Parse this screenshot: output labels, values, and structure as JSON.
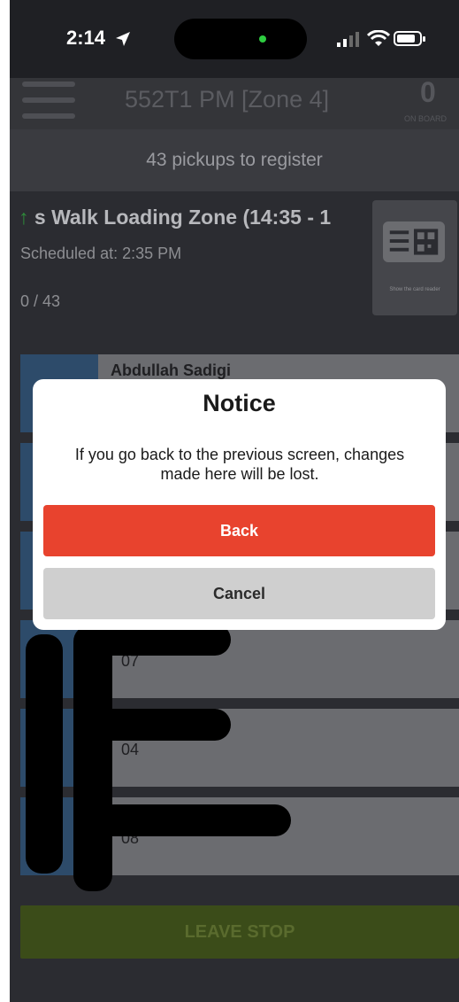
{
  "status_bar": {
    "time": "2:14"
  },
  "header": {
    "route_title": "552T1 PM [Zone 4]",
    "onboard_count": "0",
    "onboard_label": "ON BOARD"
  },
  "pickups_banner": "43 pickups to register",
  "stop": {
    "name": "s Walk Loading Zone (14:35 - 1",
    "scheduled": "Scheduled at: 2:35 PM",
    "progress": "0 / 43",
    "card_reader_label": "Show the card reader"
  },
  "students": [
    {
      "name": "Abdullah Sadigi",
      "id": ""
    },
    {
      "name": "",
      "id": "07"
    },
    {
      "name": "",
      "id": "04"
    },
    {
      "name": "",
      "id": "08"
    }
  ],
  "leave_stop_label": "LEAVE STOP",
  "modal": {
    "title": "Notice",
    "message": "If you go back to the previous screen, changes made here will be lost.",
    "back_label": "Back",
    "cancel_label": "Cancel"
  }
}
